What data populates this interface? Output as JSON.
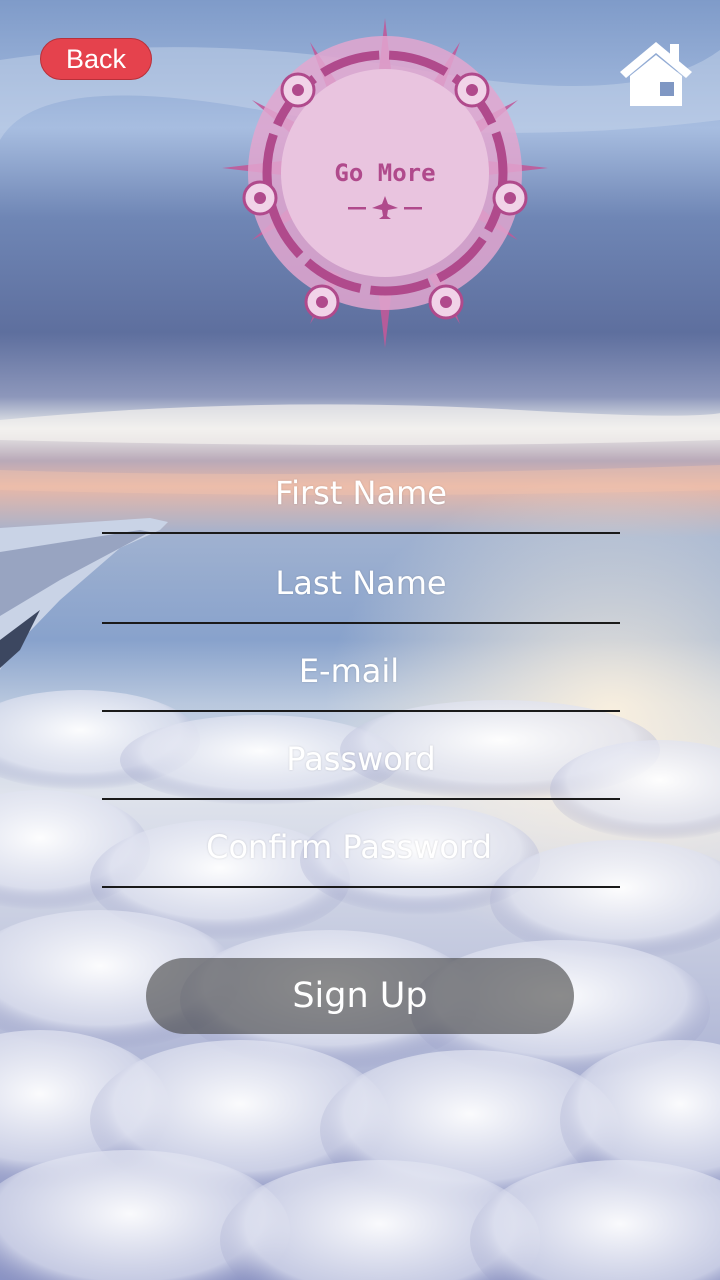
{
  "header": {
    "back_label": "Back",
    "home_icon": "home-icon"
  },
  "logo": {
    "title": "Go More",
    "icon": "airplane-icon",
    "color": "#b04a8c"
  },
  "form": {
    "first_name": "First Name",
    "last_name": "Last Name",
    "email": "E-mail",
    "password": "Password",
    "confirm_password": "Confirm Password"
  },
  "actions": {
    "signup_label": "Sign Up"
  },
  "colors": {
    "back_button": "#e5424d",
    "field_underline": "#1a1a1a",
    "signup_button": "rgba(70,70,70,0.62)"
  }
}
